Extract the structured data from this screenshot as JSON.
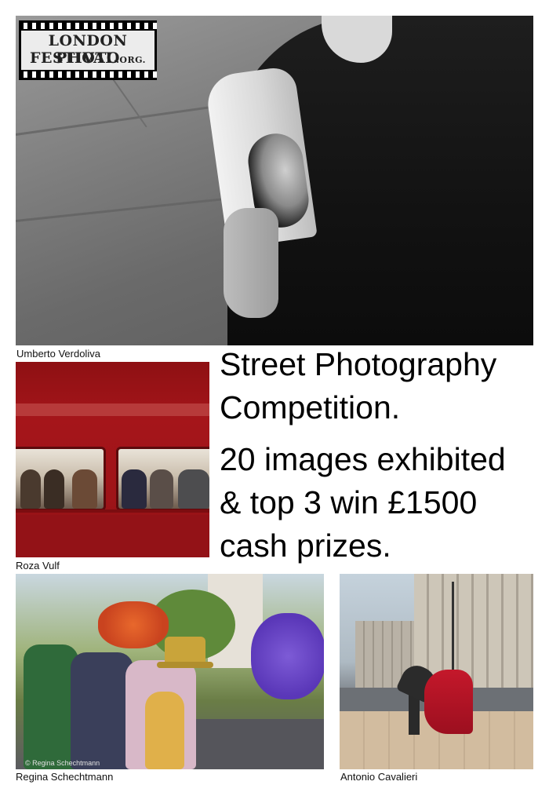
{
  "logo": {
    "line1": "LONDON PHOTO",
    "line2_main": "FESTIVAL",
    "line2_suffix": ".ORG."
  },
  "photos": [
    {
      "caption": "Umberto Verdoliva"
    },
    {
      "caption": "Roza Vulf"
    },
    {
      "caption": "Regina Schechtmann",
      "watermark": "© Regina Schechtmann"
    },
    {
      "caption": "Antonio Cavalieri"
    }
  ],
  "headline": {
    "line1": "Street Photography",
    "line2": "Competition.",
    "line3": "20 images exhibited",
    "line4": "& top 3 win £1500",
    "line5": "cash prizes."
  },
  "colors": {
    "bus_red": "#a5151a",
    "cloak_red": "#c4182b",
    "text": "#000000",
    "background": "#ffffff"
  }
}
